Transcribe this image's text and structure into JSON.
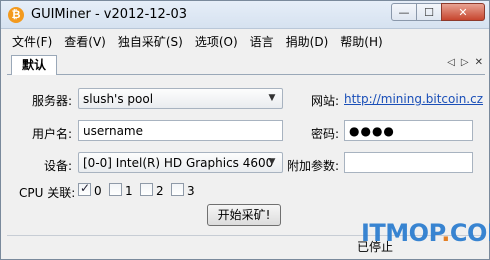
{
  "window": {
    "title": "GUIMiner - v2012-12-03",
    "app_icon": "bitcoin-icon"
  },
  "menu": [
    "文件(F)",
    "查看(V)",
    "独自采矿(S)",
    "选项(O)",
    "语言",
    "捐助(D)",
    "帮助(H)"
  ],
  "tab": {
    "label": "默认"
  },
  "form": {
    "server_label": "服务器:",
    "server_value": "slush's pool",
    "website_label": "网站:",
    "website_value": "http://mining.bitcoin.cz",
    "username_label": "用户名:",
    "username_value": "username",
    "password_label": "密码:",
    "password_value": "●●●●",
    "device_label": "设备:",
    "device_value": "[0-0] Intel(R) HD Graphics 4600",
    "extra_label": "附加参数:",
    "extra_value": "",
    "cpu_label": "CPU 关联:",
    "cpu_options": [
      {
        "label": "0",
        "checked": true
      },
      {
        "label": "1",
        "checked": false
      },
      {
        "label": "2",
        "checked": false
      },
      {
        "label": "3",
        "checked": false
      }
    ],
    "start_button": "开始采矿!"
  },
  "status": {
    "text": "已停止"
  },
  "watermark": {
    "text_a": "ITMOP",
    "text_dot": ".",
    "text_b": "COM"
  }
}
